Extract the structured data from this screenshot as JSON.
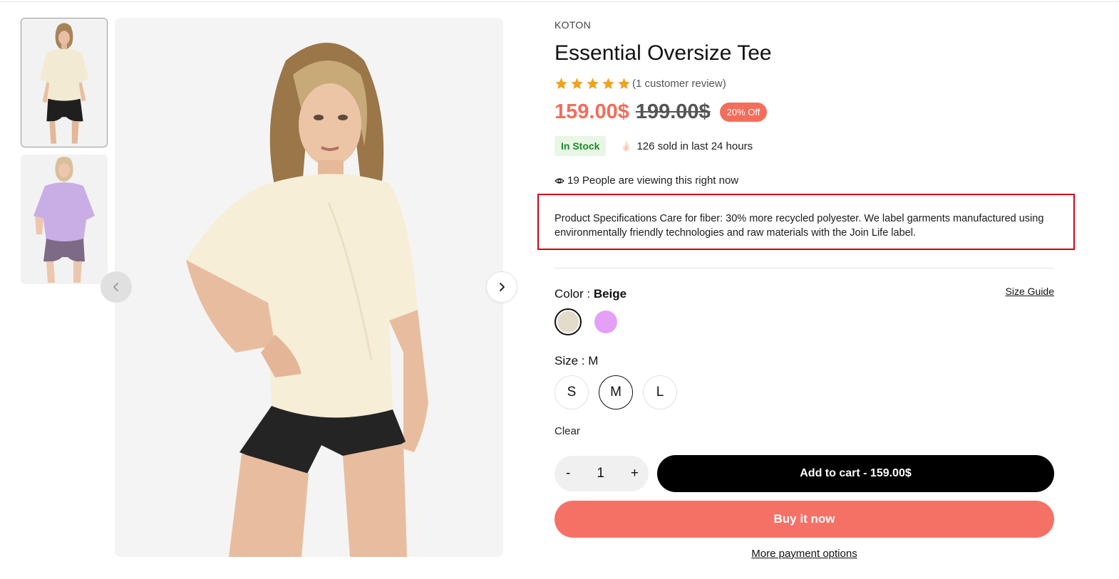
{
  "gallery": {
    "thumbnails": [
      {
        "name": "beige-tee-thumbnail",
        "active": true
      },
      {
        "name": "lilac-tee-thumbnail",
        "active": false
      }
    ],
    "prev_icon": "chevron-left-icon",
    "next_icon": "chevron-right-icon"
  },
  "product": {
    "brand": "KOTON",
    "title": "Essential Oversize Tee",
    "rating": 5,
    "rating_max": 5,
    "reviews_text": "(1 customer review)",
    "price": "159.00$",
    "old_price": "199.00$",
    "discount": "20% Off",
    "stock": "In Stock",
    "sold_text": "126 sold in last 24 hours",
    "viewers_text": "19 People are viewing this right now",
    "specifications": "Product Specifications Care for fiber: 30% more recycled polyester. We label garments manufactured using environmentally friendly technologies and raw materials with the Join Life label."
  },
  "options": {
    "color_label": "Color :",
    "color_selected": "Beige",
    "size_guide": "Size Guide",
    "swatches": [
      {
        "name": "Beige",
        "hex": "#e4dccb",
        "selected": true
      },
      {
        "name": "Lilac",
        "hex": "#e4a0f7",
        "selected": false
      }
    ],
    "size_label": "Size :",
    "size_selected": "M",
    "sizes": [
      "S",
      "M",
      "L"
    ],
    "clear": "Clear"
  },
  "cart": {
    "minus": "-",
    "quantity": "1",
    "plus": "+",
    "add_to_cart": "Add to cart - 159.00$",
    "buy_now": "Buy it now",
    "more_payment": "More payment options"
  },
  "colors": {
    "accent": "#f26d5b",
    "buy_now": "#f57166",
    "star": "#f2a31b",
    "stock_green": "#1e8a2a",
    "highlight_border": "#d0021b"
  }
}
